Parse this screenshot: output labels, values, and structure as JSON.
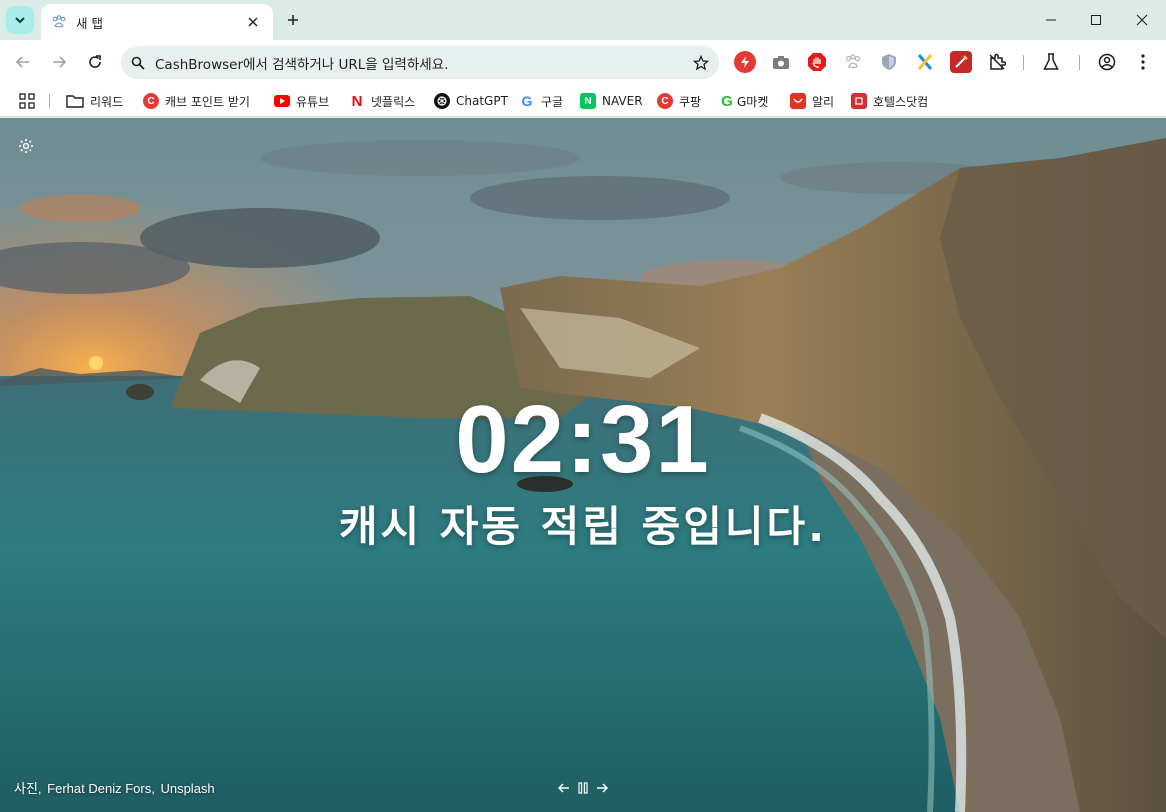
{
  "tab": {
    "title": "새 탭"
  },
  "omnibox": {
    "placeholder": "CashBrowser에서 검색하거나 URL을 입력하세요."
  },
  "bookmarks": [
    {
      "label": "리워드",
      "icon": "folder-icon"
    },
    {
      "label": "캐브 포인트 받기",
      "icon": "cashbrowser-icon",
      "color": "#e53935",
      "glyph": "C"
    },
    {
      "label": "유튜브",
      "icon": "youtube-icon",
      "color": "#ff0000"
    },
    {
      "label": "넷플릭스",
      "icon": "netflix-icon",
      "color": "#e50914",
      "glyph": "N"
    },
    {
      "label": "ChatGPT",
      "icon": "chatgpt-icon",
      "color": "#000000"
    },
    {
      "label": "구글",
      "icon": "google-icon",
      "glyph": "G"
    },
    {
      "label": "NAVER",
      "icon": "naver-icon",
      "color": "#03c75a",
      "glyph": "N"
    },
    {
      "label": "쿠팡",
      "icon": "coupang-icon",
      "color": "#e53935",
      "glyph": "C"
    },
    {
      "label": "G마켓",
      "icon": "gmarket-icon",
      "color": "#2fbb33",
      "glyph": "G"
    },
    {
      "label": "알리",
      "icon": "aliexpress-icon",
      "color": "#e43225"
    },
    {
      "label": "호텔스닷컴",
      "icon": "hotels-icon",
      "color": "#d32f2f"
    }
  ],
  "clock": {
    "time": "02:31"
  },
  "tagline": "캐시 자동 적립 중입니다.",
  "credit": {
    "prefix": "사진,",
    "author": "Ferhat Deniz Fors,",
    "source": "Unsplash"
  },
  "colors": {
    "tab_strip": "#dbece7",
    "accent": "#a9ecea",
    "omnibox": "#e6f0ee"
  }
}
